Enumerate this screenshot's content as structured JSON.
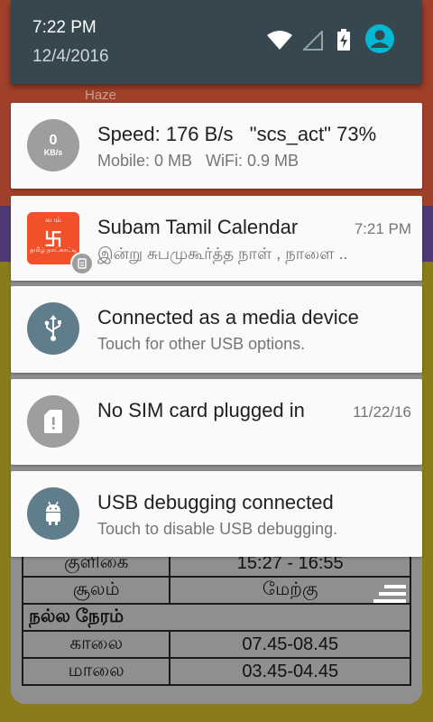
{
  "background_app": {
    "haze_label": "Haze",
    "table_rows": [
      {
        "label": "குளிகை",
        "value": "15:27 - 16:55"
      },
      {
        "label": "சூலம்",
        "value": "மேற்கு"
      }
    ],
    "section_heading": "நல்ல நேரம்",
    "good_time_rows": [
      {
        "label": "காலை",
        "value": "07.45-08.45"
      },
      {
        "label": "மாலை",
        "value": "03.45-04.45"
      }
    ]
  },
  "status_header": {
    "time": "7:22 PM",
    "date": "12/4/2016",
    "icons": [
      "wifi-icon",
      "no-signal-icon",
      "battery-charging-icon",
      "account-icon"
    ],
    "accent_color": "#00b8d4"
  },
  "notifications": [
    {
      "icon": "speed-meter-icon",
      "icon_value": "0",
      "icon_unit": "KB/s",
      "title": "Speed: 176 B/s   \"scs_act\" 73%",
      "text": "Mobile: 0 MB   WiFi: 0.9 MB"
    },
    {
      "icon": "subam-calendar-logo",
      "logo_top": "சுபம்",
      "logo_mid": "卐",
      "logo_low": "தமிழ் நாட்காட்டி",
      "title": "Subam Tamil Calendar",
      "time": "7:21 PM",
      "text": "இன்று சுபமுகூர்த்த நாள் , நாளை .."
    },
    {
      "icon": "usb-icon",
      "title": "Connected as a media device",
      "text": "Touch for other USB options."
    },
    {
      "icon": "sim-card-alert-icon",
      "title": "No SIM card plugged in",
      "time": "11/22/16"
    },
    {
      "icon": "android-debug-icon",
      "title": "USB debugging connected",
      "text": "Touch to disable USB debugging."
    }
  ]
}
